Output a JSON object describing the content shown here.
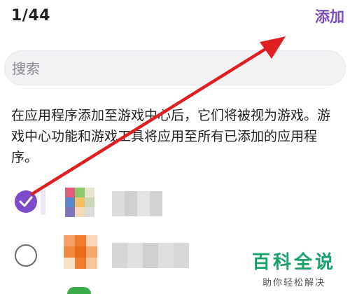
{
  "header": {
    "counter": "1/44",
    "add_label": "添加"
  },
  "search": {
    "placeholder": "搜索",
    "value": ""
  },
  "description": "在应用程序添加至游戏中心后，它们将被视为游戏。游戏中心功能和游戏工具将应用至所有已添加的应用程序。",
  "apps": [
    {
      "checked": true,
      "name_blurred": true,
      "icon": "blurred-app-icon"
    },
    {
      "checked": false,
      "name_blurred": true,
      "icon": "blurred-app-icon"
    }
  ],
  "watermark": {
    "title": "百科全说",
    "subtitle": "助你轻松解决"
  },
  "colors": {
    "accent": "#7c4dbd",
    "annotation_arrow": "#e02020",
    "watermark_green": "#1aa06a"
  }
}
